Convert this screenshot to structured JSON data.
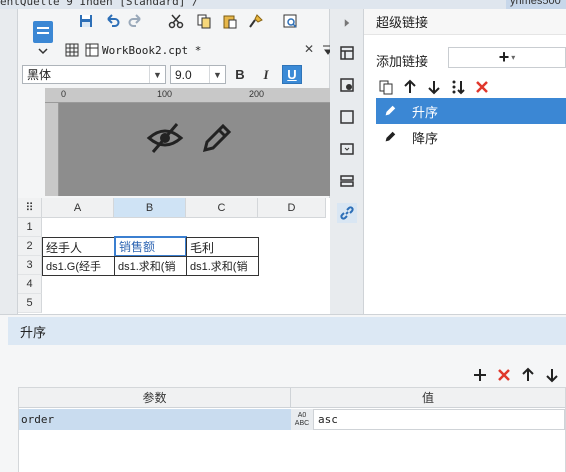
{
  "title_bar": {
    "text": "entQuelle 9 Inden [Standard]  /",
    "user": "yhmes500"
  },
  "tab": {
    "label": "WorkBook2.cpt *"
  },
  "font_bar": {
    "font": "黑体",
    "size": "9.0",
    "bold": "B",
    "italic": "I",
    "underline": "U"
  },
  "ruler": {
    "marks": [
      "0",
      "100",
      "200"
    ]
  },
  "sheet": {
    "columns": [
      "A",
      "B",
      "C",
      "D"
    ],
    "rows": [
      "1",
      "2",
      "3",
      "4",
      "5"
    ],
    "row2": [
      "经手人",
      "销售额",
      "毛利"
    ],
    "row3": [
      "ds1.G(经手",
      "ds1.求和(销",
      "ds1.求和(销"
    ]
  },
  "hyperlink_panel": {
    "title": "超级链接",
    "add_label": "添加链接",
    "add_button": "+",
    "items": [
      {
        "label": "升序",
        "selected": true
      },
      {
        "label": "降序",
        "selected": false
      }
    ]
  },
  "param_panel": {
    "header": "升序",
    "col_param": "参数",
    "col_value": "值",
    "row": {
      "param": "order",
      "value": "asc",
      "type_top": "A0",
      "type_bottom": "ABC"
    }
  },
  "colors": {
    "accent": "#3b87d4",
    "selected_row": "#c9dcef",
    "header_bg": "#dce8f4",
    "delete_red": "#e0372b"
  }
}
